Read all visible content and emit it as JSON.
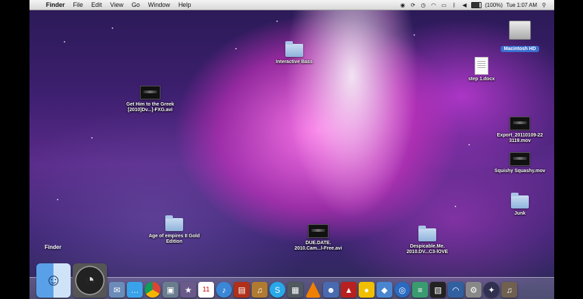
{
  "menubar": {
    "items": [
      "Finder",
      "File",
      "Edit",
      "View",
      "Go",
      "Window",
      "Help"
    ],
    "battery": "(100%)",
    "clock": "Tue 1:07 AM"
  },
  "desktop": {
    "macintosh_hd": "Macintosh HD",
    "interactive_bass": "Interactive Bass",
    "step_doc": "step 1.docx",
    "greek_video": "Get Him to the Greek [2010]Dv...]-FXG.avi",
    "export_mov": "Export_20110109-22 3119.mov",
    "squishy_mov": "Squishy Squashy.mov",
    "junk": "Junk",
    "age_of_empires": "Age of empires II Gold Edition",
    "due_date": "DUE.DATE. 2010.Cam...l-Free.avi",
    "despicable": "Despicable.Me. 2010.DV...C3-lOVE"
  },
  "dock": {
    "tooltip": "Finder",
    "icons": [
      "finder-icon",
      "dashboard-icon",
      "mail-icon",
      "ichat-icon",
      "chrome-icon",
      "iphoto-icon",
      "imovie-icon",
      "ical-icon",
      "itunes-icon",
      "photo-booth-icon",
      "garageband-icon",
      "skype-icon",
      "spaces-icon",
      "vlc-icon",
      "contacts-icon",
      "reader-icon",
      "adium-icon",
      "preview-icon",
      "safari-icon",
      "utility-icon",
      "photo-icon",
      "wifi-icon",
      "settings-icon",
      "ball-icon",
      "audio-icon"
    ]
  }
}
